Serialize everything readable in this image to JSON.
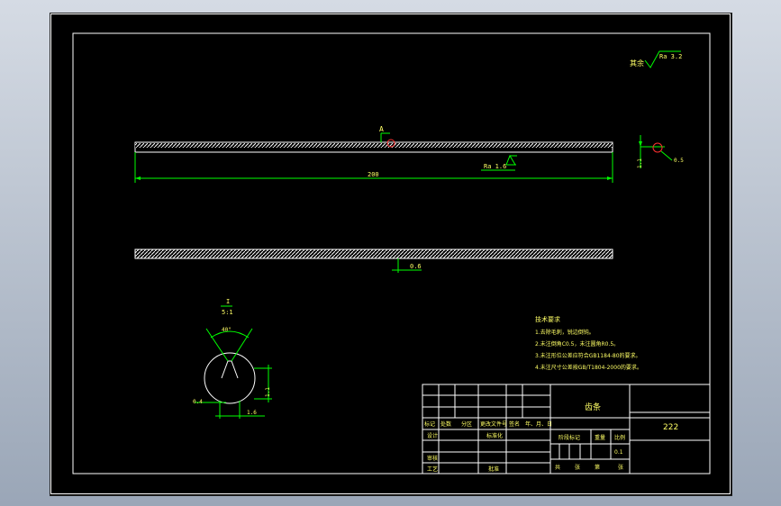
{
  "drawing": {
    "part_name": "齿条",
    "drawing_number": "222",
    "scale": "0.1",
    "length_dim": "200",
    "roughness_top": "Ra 3.2",
    "roughness_top_prefix": "其余",
    "roughness_side": "Ra 1.6",
    "datum_label": "A",
    "runout": "0.6",
    "section_scale_num": "I",
    "section_scale_den": "5:1",
    "tooth_angle": "40°",
    "dim_left": "0.4",
    "dim_bottom": "1.6",
    "dim_right": "1.1",
    "end_dim_left": "1.1",
    "end_dim_right": "0.5",
    "tech_title": "技术要求",
    "tech_notes": [
      "1.去除毛刺，锐边倒钝。",
      "2.未注倒角C0.5，未注圆角R0.5。",
      "3.未注形位公差应符合GB1184-80的要求。",
      "4.未注尺寸公差按GB/T1804-2000的要求。"
    ],
    "title_block": {
      "row_labels": [
        "标记",
        "处数",
        "分区",
        "更改文件号",
        "签名",
        "年、月、日"
      ],
      "design": "设计",
      "standardize": "标准化",
      "review": "审核",
      "process": "工艺",
      "approve": "批准",
      "stage_mark": "阶段标记",
      "weight": "重量",
      "scale_label": "比例",
      "sheets": [
        "共",
        "张",
        "第",
        "张"
      ]
    }
  },
  "colors": {
    "frame": "#ffffff",
    "green": "#00ff00",
    "white": "#ffffff",
    "red": "#ff3030",
    "title_text": "#ffff66"
  }
}
